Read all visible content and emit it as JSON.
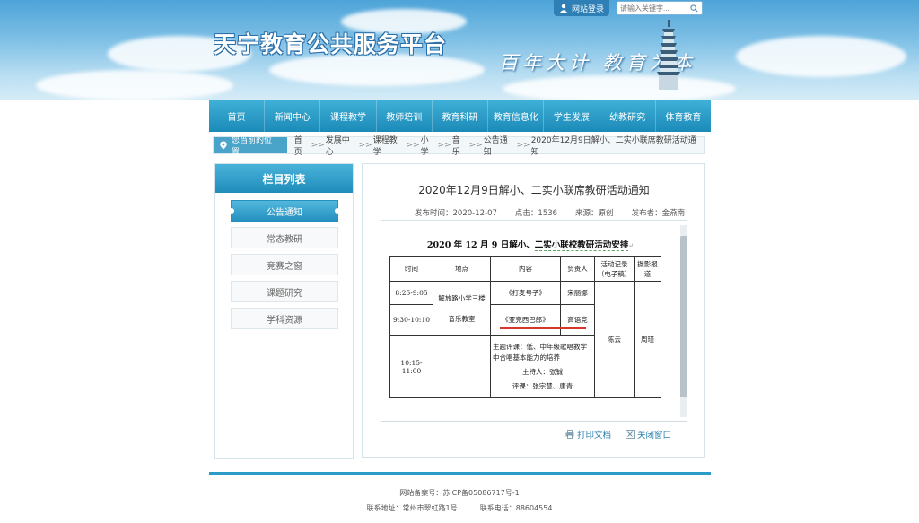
{
  "header": {
    "site_title": "天宁教育公共服务平台",
    "slogan": "百年大计 教育为本",
    "login_label": "网站登录",
    "search_placeholder": "请输入关键字..."
  },
  "nav": {
    "items": [
      "首页",
      "新闻中心",
      "课程教学",
      "教师培训",
      "教育科研",
      "教育信息化",
      "学生发展",
      "幼教研究",
      "体育教育"
    ]
  },
  "breadcrumb": {
    "label": "您当前的位置",
    "items": [
      "首页",
      "发展中心",
      "课程教学",
      "小学",
      "音乐",
      "公告通知",
      "2020年12月9日解小、二实小联席教研活动通知"
    ],
    "separator": ">>"
  },
  "sidebar": {
    "heading": "栏目列表",
    "items": [
      "公告通知",
      "常态教研",
      "竞赛之窗",
      "课题研究",
      "学科资源"
    ]
  },
  "article": {
    "title": "2020年12月9日解小、二实小联席教研活动通知",
    "publish_time": "发布时间：2020-12-07",
    "clicks": "点击：1536",
    "source": "来源：原创",
    "publisher": "发布者：金燕南",
    "doc_heading_a": "2020 年 12 月 9 日解小、",
    "doc_heading_b": "二实小联校教研活动安排",
    "para_mark": "↵",
    "table": {
      "headers": [
        "时间",
        "地点",
        "内容",
        "负责人",
        "活动记录（电子稿）",
        "摄影报道"
      ],
      "time1": "8:25-9:05",
      "time2": "9:30-10:10",
      "time3": "10:15-11:00",
      "location_a": "解放路小学三楼",
      "location_b": "音乐教室",
      "content1": "《打麦号子》",
      "content2": "《亚克西巴郎》",
      "content3a": "主题评课：低、中年级歌唱教学中合唱基本能力的培养",
      "content3b": "主持人：张铖",
      "content3c": "评课：张宗慧、唐青",
      "person1": "宋丽娜",
      "person2": "高语竞",
      "record": "陈云",
      "photo": "周瑾"
    }
  },
  "actions": {
    "print": "打印文档",
    "close": "关闭窗口"
  },
  "footer": {
    "icp": "网站备案号：苏ICP备05086717号-1",
    "address": "联系地址：常州市翠虹路1号",
    "phone": "联系电话：88604554"
  },
  "colors": {
    "nav_bg": "#1b8ab8",
    "accent": "#2a9cc7",
    "link": "#2b7fb0"
  }
}
